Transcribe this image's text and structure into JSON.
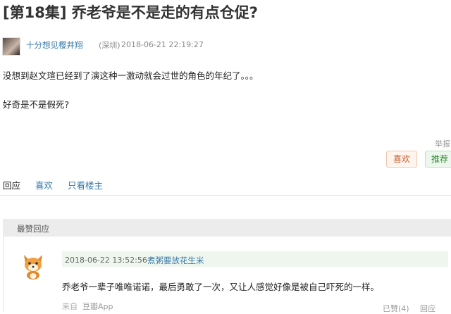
{
  "post": {
    "title": "[第18集] 乔老爷是不是走的有点仓促?",
    "author": "十分想见樱井翔",
    "location": "(深圳)",
    "timestamp": "2018-06-21 22:19:27",
    "paragraphs": [
      "没想到赵文瑄已经到了演这种一激动就会过世的角色的年纪了。。。",
      "好奇是不是假死?"
    ],
    "report_label": "举报",
    "like_button": "喜欢",
    "recommend_button": "推荐"
  },
  "actions": {
    "reply": "回应",
    "like": "喜欢",
    "only_op": "只看楼主"
  },
  "best_replies": {
    "title": "最赞回应",
    "items": [
      {
        "timestamp": "2018-06-22 13:52:56",
        "user": "煮粥要放花生米",
        "text": "乔老爷一辈子唯唯诺诺，最后勇敢了一次，又让人感觉好像是被自己吓死的一样。",
        "from_label": "来自",
        "app": "豆瓣App",
        "liked": "已赞(4)",
        "reply": "回应"
      }
    ]
  },
  "colors": {
    "link": "#3377aa",
    "like_button_bg": "#fff4ee",
    "recommend_button_bg": "#eef7ee",
    "section_bar_bg": "#ececec",
    "reply_meta_bg": "#eef6ee"
  },
  "icons": {
    "author_avatar": "user-avatar-photo",
    "reply_avatar": "fox-avatar-icon"
  }
}
